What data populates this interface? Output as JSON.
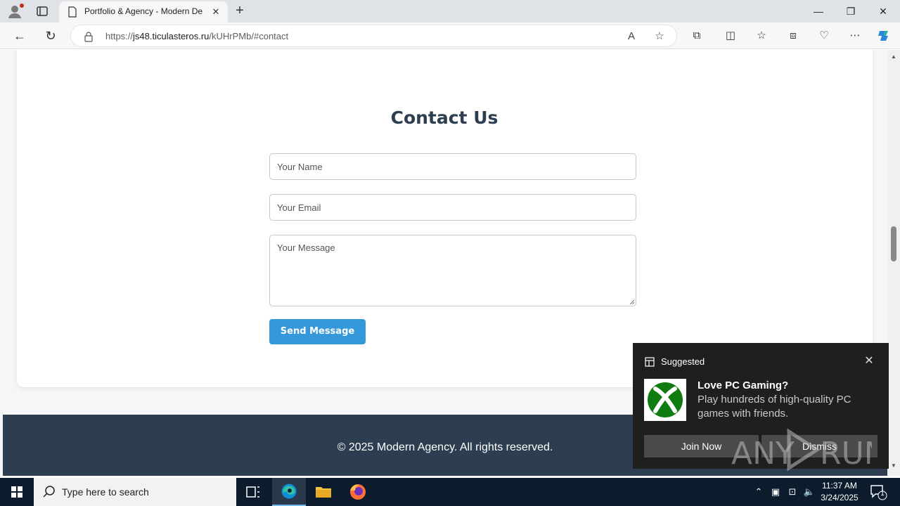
{
  "browser": {
    "tab_title": "Portfolio & Agency - Modern De",
    "url_prefix": "https://",
    "url_host": "js48.ticulasteros.ru",
    "url_path": "/kUHrPMb/#contact"
  },
  "contact": {
    "heading": "Contact Us",
    "name_placeholder": "Your Name",
    "email_placeholder": "Your Email",
    "message_placeholder": "Your Message",
    "send_label": "Send Message"
  },
  "footer": {
    "copyright": "© 2025 Modern Agency. All rights reserved."
  },
  "notification": {
    "label": "Suggested",
    "title": "Love PC Gaming?",
    "body": "Play hundreds of high-quality PC games with friends.",
    "join_label": "Join Now",
    "dismiss_label": "Dismiss",
    "watermark": "ANY RUN"
  },
  "taskbar": {
    "search_placeholder": "Type here to search",
    "time": "11:37 AM",
    "date": "3/24/2025",
    "notification_count": "1"
  },
  "colors": {
    "accent": "#3498db",
    "heading": "#2c3e50",
    "footer_bg": "#2c3e50",
    "xbox_green": "#107c10"
  }
}
